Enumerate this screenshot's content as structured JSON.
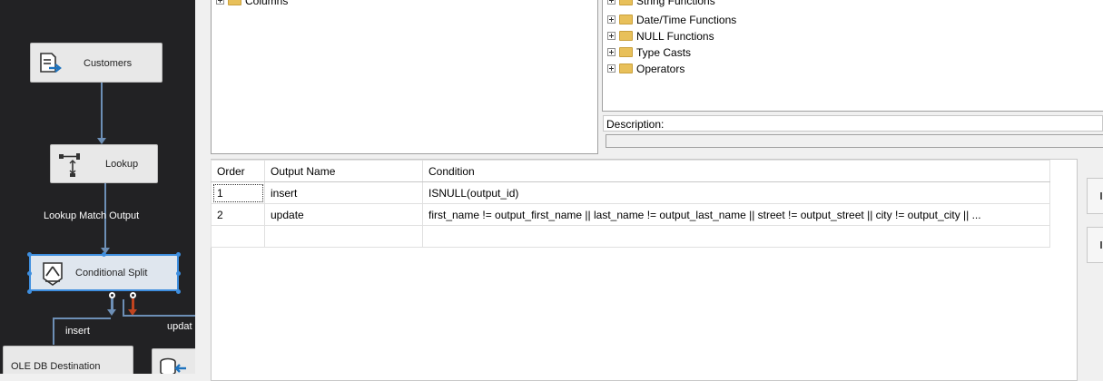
{
  "designer": {
    "tasks": {
      "customers": "Customers",
      "lookup": "Lookup",
      "conditional_split": "Conditional Split",
      "ole_db_destination": "OLE DB Destination"
    },
    "paths": {
      "lookup_match_output": "Lookup Match Output",
      "insert": "insert",
      "update_partial": "updat"
    }
  },
  "columns_tree": {
    "items": [
      "Columns"
    ]
  },
  "functions_tree": {
    "items": [
      "String Functions",
      "Date/Time Functions",
      "NULL Functions",
      "Type Casts",
      "Operators"
    ]
  },
  "description": {
    "label": "Description:",
    "value": ""
  },
  "conditions_grid": {
    "headers": [
      "Order",
      "Output Name",
      "Condition"
    ],
    "rows": [
      [
        "1",
        "insert",
        "ISNULL(output_id)"
      ],
      [
        "2",
        "update",
        "first_name != output_first_name || last_name != output_last_name || street != output_street || city != output_city || ..."
      ],
      [
        "",
        "",
        ""
      ]
    ]
  },
  "colors": {
    "canvas_bg": "#222224",
    "path_blue": "#6d8fb6",
    "path_error_red": "#c1441f",
    "selection_blue": "#3e8ede",
    "folder_yellow": "#e8c05a"
  }
}
